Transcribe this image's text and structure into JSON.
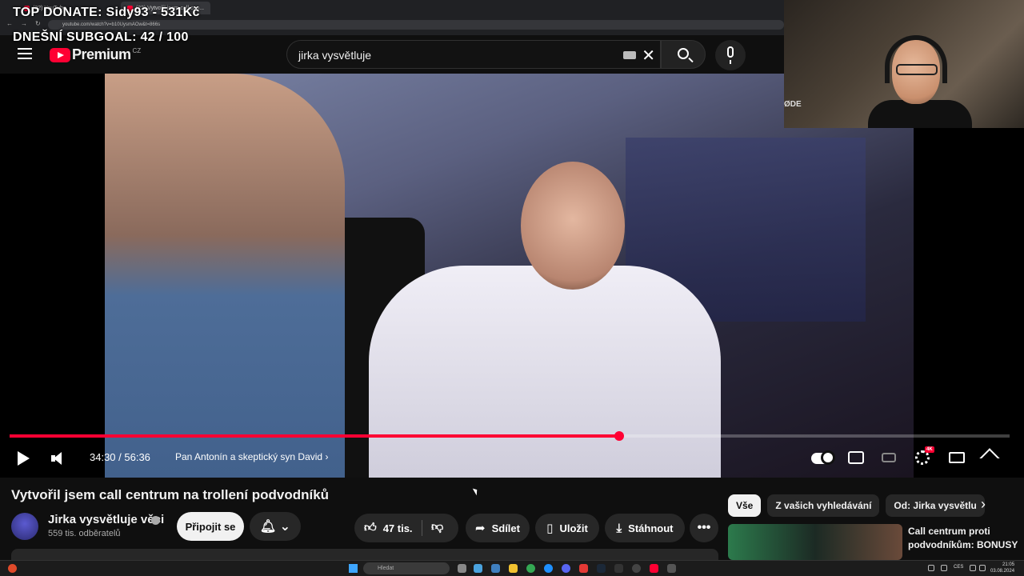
{
  "browser": {
    "tabs": [
      "(22) YouTube",
      "(22) Vytvořil jsem call cen..."
    ],
    "url": "youtube.com/watch?v=b10UysmAOw&t=866s"
  },
  "overlay": {
    "top_donate": "TOP DONATE: Sidy93 - 531Kč",
    "subgoal": "DNEŠNÍ SUBGOAL:  42 / 100"
  },
  "header": {
    "logo_text": "Premium",
    "logo_country": "CZ",
    "search_value": "jirka vysvětluje",
    "icons": {
      "menu": "hamburger-menu-icon",
      "search": "search-icon",
      "mic": "microphone-icon",
      "clear": "close-icon"
    }
  },
  "webcam": {
    "brand_text": "ØDE"
  },
  "player": {
    "progress_fraction": 0.6096,
    "time": "34:30 / 56:36",
    "chapter": "Pan Antonín a skeptický syn David",
    "quality_badge": "4K",
    "accent": "#ff0033"
  },
  "video": {
    "title": "Vytvořil jsem call centrum na trollení podvodníků",
    "channel": "Jirka vysvětluje věci",
    "subscribers": "559 tis. odběratelů",
    "subscribe_label": "Připojit se",
    "likes": "47 tis.",
    "share_label": "Sdílet",
    "save_label": "Uložit",
    "download_label": "Stáhnout",
    "more_label": "•••"
  },
  "chips": [
    "Vše",
    "Z vašich vyhledávání",
    "Od: Jirka vysvětlu"
  ],
  "recommendation": {
    "title": "Call centrum proti podvodníkům: BONUSY"
  },
  "taskbar": {
    "search_placeholder": "Hledat",
    "lang": "CES",
    "time": "21:05",
    "date": "03.08.2024"
  }
}
